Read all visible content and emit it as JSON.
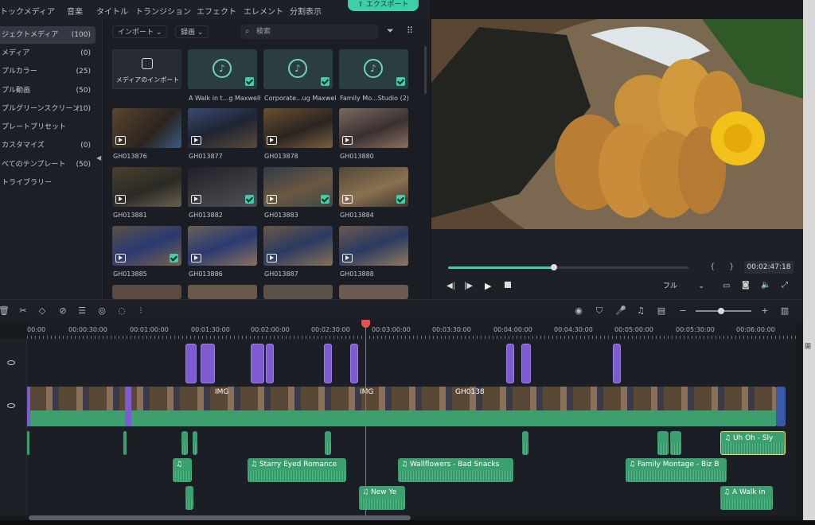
{
  "topbar": {
    "items": [
      "トックメディア",
      "音楽",
      "タイトル",
      "トランジション",
      "エフェクト",
      "エレメント",
      "分割表示"
    ],
    "export_label": "エクスポート"
  },
  "sidebar": {
    "items": [
      {
        "label": "ジェクトメディア",
        "count": "(100)"
      },
      {
        "label": "メディア",
        "count": "(0)"
      },
      {
        "label": "プルカラー",
        "count": "(25)"
      },
      {
        "label": "プル動画",
        "count": "(50)"
      },
      {
        "label": "プルグリーンスクリーン",
        "count": "(10)"
      },
      {
        "label": "プレートプリセット",
        "count": ""
      },
      {
        "label": "カスタマイズ",
        "count": "(0)"
      },
      {
        "label": "べてのテンプレート",
        "count": "(50)"
      },
      {
        "label": "トライブラリー",
        "count": ""
      }
    ]
  },
  "media": {
    "import_dropdown": "インポート",
    "record_dropdown": "録画",
    "search_placeholder": "検索",
    "import_tile_label": "メディアのインポート",
    "audio": [
      "A Walk in t...g Maxwell",
      "Corporate...ug Maxwell",
      "Family Mo...Studio (2)"
    ],
    "clips": [
      "GH013876",
      "GH013877",
      "GH013878",
      "GH013880",
      "GH013881",
      "GH013882",
      "GH013883",
      "GH013884",
      "GH013885",
      "GH013886",
      "GH013887",
      "GH013888"
    ]
  },
  "player": {
    "timecode": "00:02:47:18",
    "quality": "フル",
    "progress": 0.44
  },
  "timeline": {
    "ruler": [
      "00:00",
      "00:00:30:00",
      "00:01:00:00",
      "00:01:30:00",
      "00:02:00:00",
      "00:02:30:00",
      "00:03:00:00",
      "00:03:30:00",
      "00:04:00:00",
      "00:04:30:00",
      "00:05:00:00",
      "00:05:30:00",
      "00:06:00:00"
    ],
    "video_labels": [
      "IMG",
      "IMG",
      "GH0138"
    ],
    "audio_clips": [
      "Uh Oh - Sly",
      "Starry Eyed Romance",
      "Wallflowers - Bad Snacks",
      "Family Montage - Biz B",
      "New Ye",
      "A Walk in"
    ]
  },
  "right_edge_text": "開"
}
